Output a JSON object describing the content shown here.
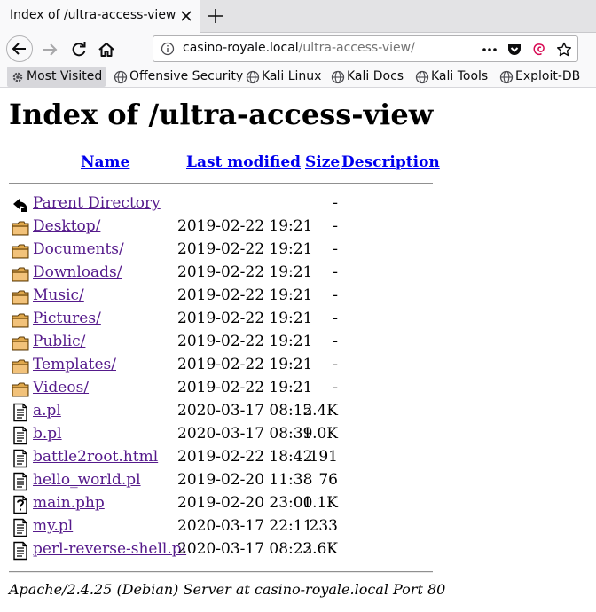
{
  "tab": {
    "title": "Index of /ultra-access-view"
  },
  "url": {
    "host": "casino-royale.local",
    "path": "/ultra-access-view/"
  },
  "bookmarks": [
    {
      "label": "Most Visited"
    },
    {
      "label": "Offensive Security"
    },
    {
      "label": "Kali Linux"
    },
    {
      "label": "Kali Docs"
    },
    {
      "label": "Kali Tools"
    },
    {
      "label": "Exploit-DB"
    }
  ],
  "page": {
    "title": "Index of /ultra-access-view",
    "columns": {
      "name": "Name",
      "modified": "Last modified",
      "size": "Size",
      "description": "Description"
    },
    "rows": [
      {
        "icon": "back-icon",
        "name": "Parent Directory",
        "modified": "",
        "size": "-"
      },
      {
        "icon": "folder-icon",
        "name": "Desktop/",
        "modified": "2019-02-22 19:21",
        "size": "-"
      },
      {
        "icon": "folder-icon",
        "name": "Documents/",
        "modified": "2019-02-22 19:21",
        "size": "-"
      },
      {
        "icon": "folder-icon",
        "name": "Downloads/",
        "modified": "2019-02-22 19:21",
        "size": "-"
      },
      {
        "icon": "folder-icon",
        "name": "Music/",
        "modified": "2019-02-22 19:21",
        "size": "-"
      },
      {
        "icon": "folder-icon",
        "name": "Pictures/",
        "modified": "2019-02-22 19:21",
        "size": "-"
      },
      {
        "icon": "folder-icon",
        "name": "Public/",
        "modified": "2019-02-22 19:21",
        "size": "-"
      },
      {
        "icon": "folder-icon",
        "name": "Templates/",
        "modified": "2019-02-22 19:21",
        "size": "-"
      },
      {
        "icon": "folder-icon",
        "name": "Videos/",
        "modified": "2019-02-22 19:21",
        "size": "-"
      },
      {
        "icon": "text-file-icon",
        "name": "a.pl",
        "modified": "2020-03-17 08:12",
        "size": "5.4K"
      },
      {
        "icon": "text-file-icon",
        "name": "b.pl",
        "modified": "2020-03-17 08:39",
        "size": "1.0K"
      },
      {
        "icon": "text-file-icon",
        "name": "battle2root.html",
        "modified": "2019-02-22 18:42",
        "size": "191"
      },
      {
        "icon": "text-file-icon",
        "name": "hello_world.pl",
        "modified": "2019-02-20 11:38",
        "size": "76"
      },
      {
        "icon": "unknown-file-icon",
        "name": "main.php",
        "modified": "2019-02-20 23:00",
        "size": "1.1K"
      },
      {
        "icon": "text-file-icon",
        "name": "my.pl",
        "modified": "2020-03-17 22:11",
        "size": "233"
      },
      {
        "icon": "text-file-icon",
        "name": "perl-reverse-shell.pl",
        "modified": "2020-03-17 08:22",
        "size": "3.6K"
      }
    ],
    "address": "Apache/2.4.25 (Debian) Server at casino-royale.local Port 80"
  },
  "colors": {
    "link": "#0000ee",
    "visited": "#551a8b",
    "chrome": "#f9f9fa"
  }
}
